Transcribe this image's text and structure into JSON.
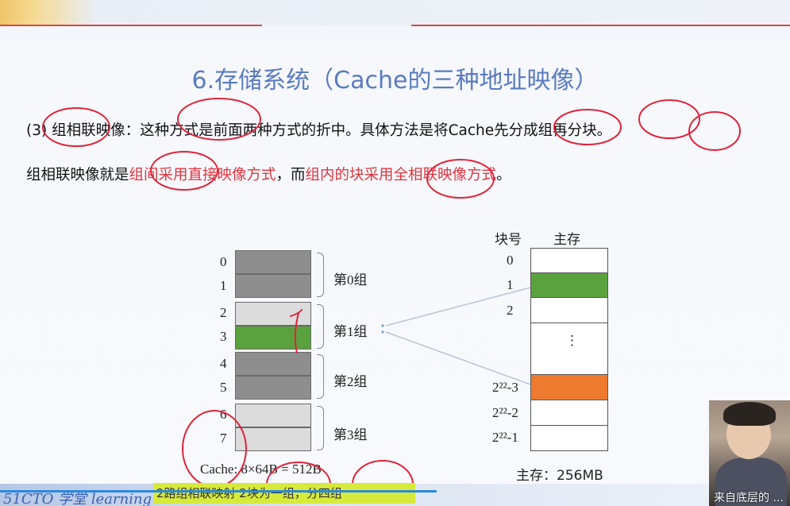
{
  "title": "6.存储系统（Cache的三种地址映像）",
  "para1": {
    "prefix": "(3) 组相联映像：这种方式是前面两种方式的折中。具体方法是将Cache先分成组再分块。"
  },
  "para2": {
    "part1": "组相联映像就是",
    "part2": "组间采用直接映像方式",
    "part3": "，而",
    "part4": "组内的块采用全相联映像方式",
    "part5": "。"
  },
  "cache": {
    "rows": [
      "0",
      "1",
      "2",
      "3",
      "4",
      "5",
      "6",
      "7"
    ],
    "groups": [
      "第0组",
      "第1组",
      "第2组",
      "第3组"
    ],
    "caption": "Cache: 8×64B = 512B"
  },
  "memory": {
    "header_block": "块号",
    "header_main": "主存",
    "labels": [
      "0",
      "1",
      "2",
      "2²²-3",
      "2²²-2",
      "2²²-1"
    ],
    "dots": "⋮",
    "caption": "主存：256MB"
  },
  "bottom": {
    "brand": "51CTO 学堂 learning",
    "highlight": "2路组相联映射    2块为一组，分四组"
  },
  "webcam": {
    "caption": "来自底层的 ..."
  },
  "colors": {
    "gray_dark": "#8e8e8e",
    "gray_light": "#dcdcdc",
    "green": "#5aa23e",
    "orange": "#ee7a30",
    "red_text": "#e0343f",
    "title_blue": "#5b7bc0"
  }
}
